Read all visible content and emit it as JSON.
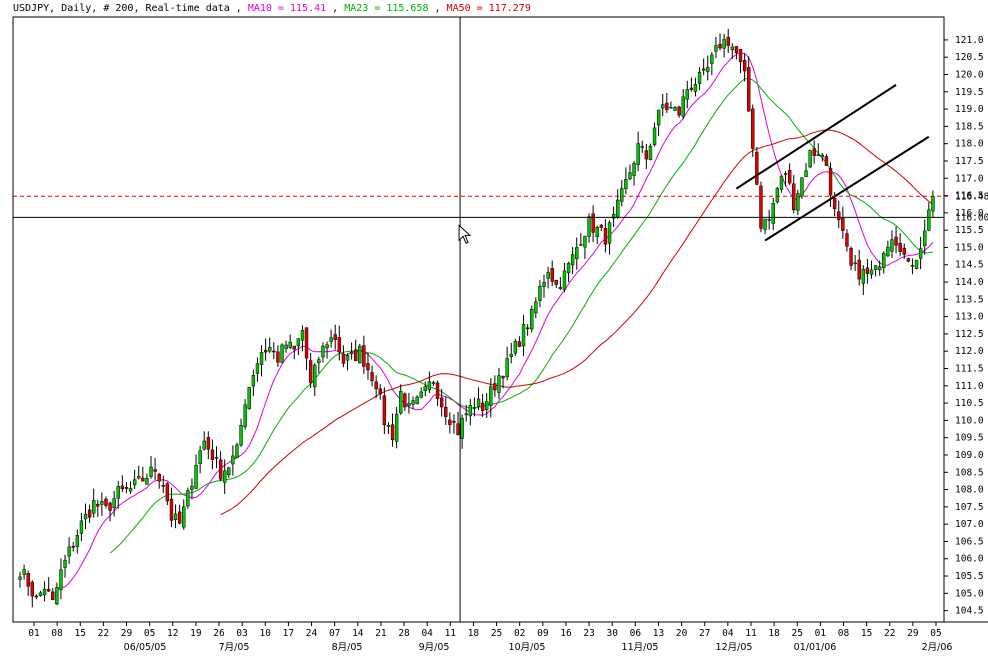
{
  "header": {
    "symbol": "USDJPY",
    "sep1": ", ",
    "period": "Daily",
    "sep2": ", ",
    "bars": "# 200",
    "sep3": ", ",
    "feed": "Real-time data",
    "sep4": " , ",
    "ma10_text": "MA10 = 115.41",
    "sep5": " , ",
    "ma23_text": "MA23 = 115.658",
    "sep6": " , ",
    "ma50_text": "MA50 = 117.279"
  },
  "colors": {
    "background": "#ffffff",
    "up_candle": "#00c800",
    "down_candle": "#e00000",
    "ma10": "#e000e0",
    "ma23": "#00b000",
    "ma50": "#d00000",
    "price_line": "#e00000",
    "crosshair_value": "#0000ff"
  },
  "chart_data": {
    "type": "candlestick",
    "symbol": "USDJPY",
    "period": "Daily",
    "y_range": [
      104.0,
      121.5
    ],
    "y_ticks": [
      "121.0",
      "120.5",
      "120.0",
      "119.5",
      "119.0",
      "118.5",
      "118.0",
      "117.5",
      "117.0",
      "116.5",
      "116.0",
      "115.5",
      "115.0",
      "114.5",
      "114.0",
      "113.5",
      "113.0",
      "112.5",
      "112.0",
      "111.5",
      "111.0",
      "110.5",
      "110.0",
      "109.5",
      "109.0",
      "108.5",
      "108.0",
      "107.5",
      "107.0",
      "106.5",
      "106.0",
      "105.5",
      "105.0",
      "104.5"
    ],
    "last_price_label": "116.48",
    "last_price": 116.48,
    "crosshair_label": "116.00",
    "crosshair_price": 115.87,
    "x_day_labels": [
      "01",
      "08",
      "15",
      "22",
      "29",
      "05",
      "12",
      "19",
      "26",
      "03",
      "10",
      "17",
      "24",
      "07",
      "14",
      "21",
      "28",
      "04",
      "11",
      "18",
      "25",
      "02",
      "09",
      "16",
      "23",
      "30",
      "06",
      "13",
      "20",
      "27",
      "04",
      "11",
      "18",
      "25",
      "01",
      "08",
      "15",
      "22",
      "29",
      "05"
    ],
    "x_month_labels": [
      "06/05/05",
      "7月/05",
      "8月/05",
      "9月/05",
      "10月/05",
      "11月/05",
      "12月/05",
      "01/01/06",
      "2月/06"
    ],
    "anchors": [
      [
        0,
        105.7
      ],
      [
        2,
        105.3
      ],
      [
        4,
        104.8
      ],
      [
        6,
        105.2
      ],
      [
        8,
        104.7
      ],
      [
        10,
        105.6
      ],
      [
        12,
        106.2
      ],
      [
        15,
        107.0
      ],
      [
        18,
        107.6
      ],
      [
        21,
        107.4
      ],
      [
        24,
        107.9
      ],
      [
        27,
        108.0
      ],
      [
        30,
        108.3
      ],
      [
        33,
        108.6
      ],
      [
        35,
        108.2
      ],
      [
        37,
        107.2
      ],
      [
        39,
        107.0
      ],
      [
        41,
        107.8
      ],
      [
        43,
        108.8
      ],
      [
        45,
        109.4
      ],
      [
        47,
        109.0
      ],
      [
        49,
        108.5
      ],
      [
        51,
        108.7
      ],
      [
        53,
        109.1
      ],
      [
        55,
        110.6
      ],
      [
        57,
        111.4
      ],
      [
        59,
        112.0
      ],
      [
        61,
        112.1
      ],
      [
        63,
        111.8
      ],
      [
        65,
        112.2
      ],
      [
        67,
        112.0
      ],
      [
        69,
        112.6
      ],
      [
        71,
        111.0
      ],
      [
        73,
        111.8
      ],
      [
        75,
        112.3
      ],
      [
        77,
        112.4
      ],
      [
        79,
        111.7
      ],
      [
        81,
        111.8
      ],
      [
        83,
        112.0
      ],
      [
        85,
        111.5
      ],
      [
        87,
        111.1
      ],
      [
        89,
        110.0
      ],
      [
        91,
        109.6
      ],
      [
        93,
        110.8
      ],
      [
        95,
        110.3
      ],
      [
        97,
        110.5
      ],
      [
        99,
        110.8
      ],
      [
        101,
        111.2
      ],
      [
        103,
        110.5
      ],
      [
        105,
        110.1
      ],
      [
        107,
        109.7
      ],
      [
        109,
        110.2
      ],
      [
        111,
        110.5
      ],
      [
        113,
        110.4
      ],
      [
        115,
        110.8
      ],
      [
        117,
        111.3
      ],
      [
        119,
        111.6
      ],
      [
        121,
        112.1
      ],
      [
        123,
        112.6
      ],
      [
        125,
        113.0
      ],
      [
        127,
        113.8
      ],
      [
        129,
        114.4
      ],
      [
        131,
        113.9
      ],
      [
        133,
        114.2
      ],
      [
        135,
        114.7
      ],
      [
        137,
        115.3
      ],
      [
        139,
        115.7
      ],
      [
        141,
        115.5
      ],
      [
        143,
        115.3
      ],
      [
        145,
        115.8
      ],
      [
        147,
        116.5
      ],
      [
        149,
        117.2
      ],
      [
        151,
        117.9
      ],
      [
        153,
        117.6
      ],
      [
        155,
        118.5
      ],
      [
        157,
        119.1
      ],
      [
        159,
        119.0
      ],
      [
        161,
        118.9
      ],
      [
        163,
        119.6
      ],
      [
        165,
        119.8
      ],
      [
        167,
        119.9
      ],
      [
        169,
        120.4
      ],
      [
        171,
        120.9
      ],
      [
        173,
        121.0
      ],
      [
        175,
        120.6
      ],
      [
        177,
        119.9
      ],
      [
        179,
        118.0
      ],
      [
        181,
        115.7
      ],
      [
        183,
        115.8
      ],
      [
        185,
        116.7
      ],
      [
        187,
        117.2
      ],
      [
        189,
        116.3
      ],
      [
        191,
        117.0
      ],
      [
        193,
        117.7
      ],
      [
        195,
        117.8
      ],
      [
        197,
        117.4
      ],
      [
        199,
        116.0
      ],
      [
        201,
        115.3
      ],
      [
        203,
        114.4
      ],
      [
        205,
        114.3
      ],
      [
        207,
        114.2
      ],
      [
        209,
        114.3
      ],
      [
        211,
        115.0
      ],
      [
        213,
        115.4
      ],
      [
        215,
        115.1
      ],
      [
        217,
        114.4
      ],
      [
        219,
        114.8
      ],
      [
        221,
        115.4
      ],
      [
        222,
        116.2
      ],
      [
        223,
        116.5
      ]
    ],
    "moving_averages": [
      {
        "name": "MA10",
        "value": 115.41
      },
      {
        "name": "MA23",
        "value": 115.658
      },
      {
        "name": "MA50",
        "value": 117.279
      }
    ],
    "channel_lines": [
      {
        "from": [
          175,
          116.7
        ],
        "to": [
          214,
          119.7
        ]
      },
      {
        "from": [
          182,
          115.2
        ],
        "to": [
          222,
          118.2
        ]
      }
    ],
    "grid": false,
    "legend": "top-left"
  }
}
